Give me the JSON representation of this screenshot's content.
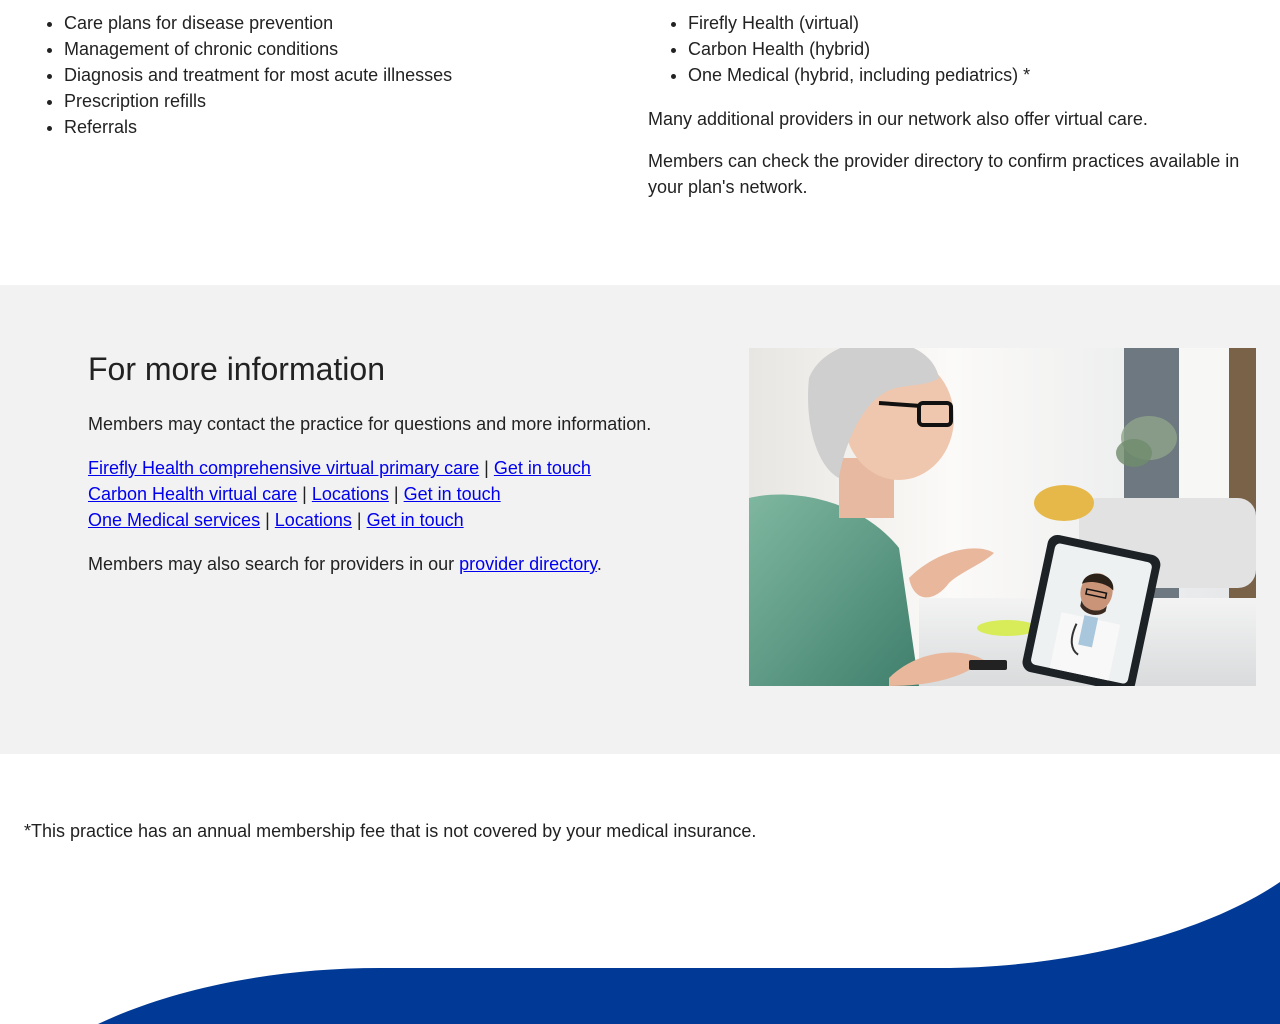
{
  "services_list": [
    "Care plans for disease prevention",
    "Management of chronic conditions",
    "Diagnosis and treatment for most acute illnesses",
    "Prescription refills",
    "Referrals"
  ],
  "providers_list": [
    "Firefly Health (virtual)",
    "Carbon Health (hybrid)",
    "One Medical (hybrid, including pediatrics) *"
  ],
  "virtual_care_note": "Many additional providers in our network also offer virtual care.",
  "directory_note": "Members can check the provider directory to confirm practices available in your plan's network.",
  "info": {
    "title": "For more information",
    "intro": "Members may contact the practice for questions and more information.",
    "separator": "|",
    "links": {
      "firefly_primary_care": "Firefly Health comprehensive virtual primary care",
      "firefly_get_in_touch": "Get in touch",
      "carbon_virtual_care": "Carbon Health virtual care",
      "carbon_locations": "Locations",
      "carbon_get_in_touch": "Get in touch",
      "one_medical_services": "One Medical services",
      "one_medical_locations": "Locations",
      "one_medical_get_in_touch": "Get in touch"
    },
    "search_prefix": "Members may also search for providers in our ",
    "provider_directory_link": "provider directory",
    "search_suffix": "."
  },
  "footnote": "*This practice has an annual membership fee that is not covered by your medical insurance.",
  "colors": {
    "band_background": "#f2f2f2",
    "link": "#0000ee",
    "wave": "#003a96"
  }
}
